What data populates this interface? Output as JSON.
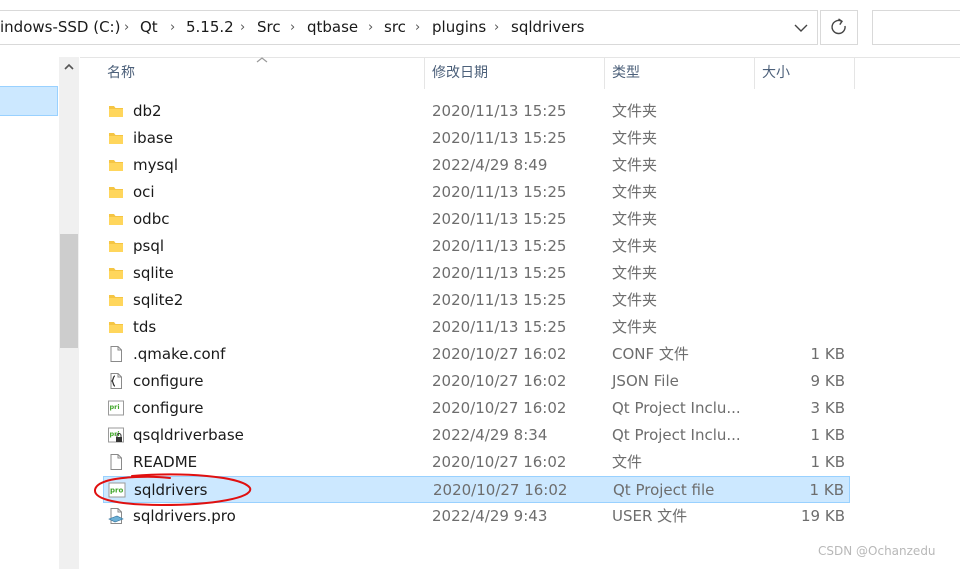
{
  "breadcrumbs": [
    "indows-SSD (C:)",
    "Qt",
    "5.15.2",
    "Src",
    "qtbase",
    "src",
    "plugins",
    "sqldrivers"
  ],
  "columns": {
    "name": "名称",
    "date": "修改日期",
    "type": "类型",
    "size": "大小"
  },
  "files": [
    {
      "name": "db2",
      "date": "2020/11/13 15:25",
      "type": "文件夹",
      "size": "",
      "icon": "folder-icon"
    },
    {
      "name": "ibase",
      "date": "2020/11/13 15:25",
      "type": "文件夹",
      "size": "",
      "icon": "folder-icon"
    },
    {
      "name": "mysql",
      "date": "2022/4/29 8:49",
      "type": "文件夹",
      "size": "",
      "icon": "folder-icon"
    },
    {
      "name": "oci",
      "date": "2020/11/13 15:25",
      "type": "文件夹",
      "size": "",
      "icon": "folder-icon"
    },
    {
      "name": "odbc",
      "date": "2020/11/13 15:25",
      "type": "文件夹",
      "size": "",
      "icon": "folder-icon"
    },
    {
      "name": "psql",
      "date": "2020/11/13 15:25",
      "type": "文件夹",
      "size": "",
      "icon": "folder-icon"
    },
    {
      "name": "sqlite",
      "date": "2020/11/13 15:25",
      "type": "文件夹",
      "size": "",
      "icon": "folder-icon"
    },
    {
      "name": "sqlite2",
      "date": "2020/11/13 15:25",
      "type": "文件夹",
      "size": "",
      "icon": "folder-icon"
    },
    {
      "name": "tds",
      "date": "2020/11/13 15:25",
      "type": "文件夹",
      "size": "",
      "icon": "folder-icon"
    },
    {
      "name": ".qmake.conf",
      "date": "2020/10/27 16:02",
      "type": "CONF 文件",
      "size": "1 KB",
      "icon": "blank-file-icon"
    },
    {
      "name": "configure",
      "date": "2020/10/27 16:02",
      "type": "JSON File",
      "size": "9 KB",
      "icon": "json-file-icon"
    },
    {
      "name": "configure",
      "date": "2020/10/27 16:02",
      "type": "Qt Project Inclu...",
      "size": "3 KB",
      "icon": "pri-file-icon"
    },
    {
      "name": "qsqldriverbase",
      "date": "2022/4/29 8:34",
      "type": "Qt Project Inclu...",
      "size": "1 KB",
      "icon": "pri-lock-file-icon"
    },
    {
      "name": "README",
      "date": "2020/10/27 16:02",
      "type": "文件",
      "size": "1 KB",
      "icon": "blank-file-icon"
    },
    {
      "name": "sqldrivers",
      "date": "2020/10/27 16:02",
      "type": "Qt Project file",
      "size": "1 KB",
      "icon": "pro-file-icon",
      "selected": true
    },
    {
      "name": "sqldrivers.pro",
      "date": "2022/4/29 9:43",
      "type": "USER 文件",
      "size": "19 KB",
      "icon": "user-file-icon"
    }
  ],
  "watermark": "CSDN @Ochanzedu",
  "colors": {
    "selection": "#cce8ff",
    "selection_border": "#99d1ff",
    "folder": "#f5c543",
    "annotation": "#e01010"
  }
}
